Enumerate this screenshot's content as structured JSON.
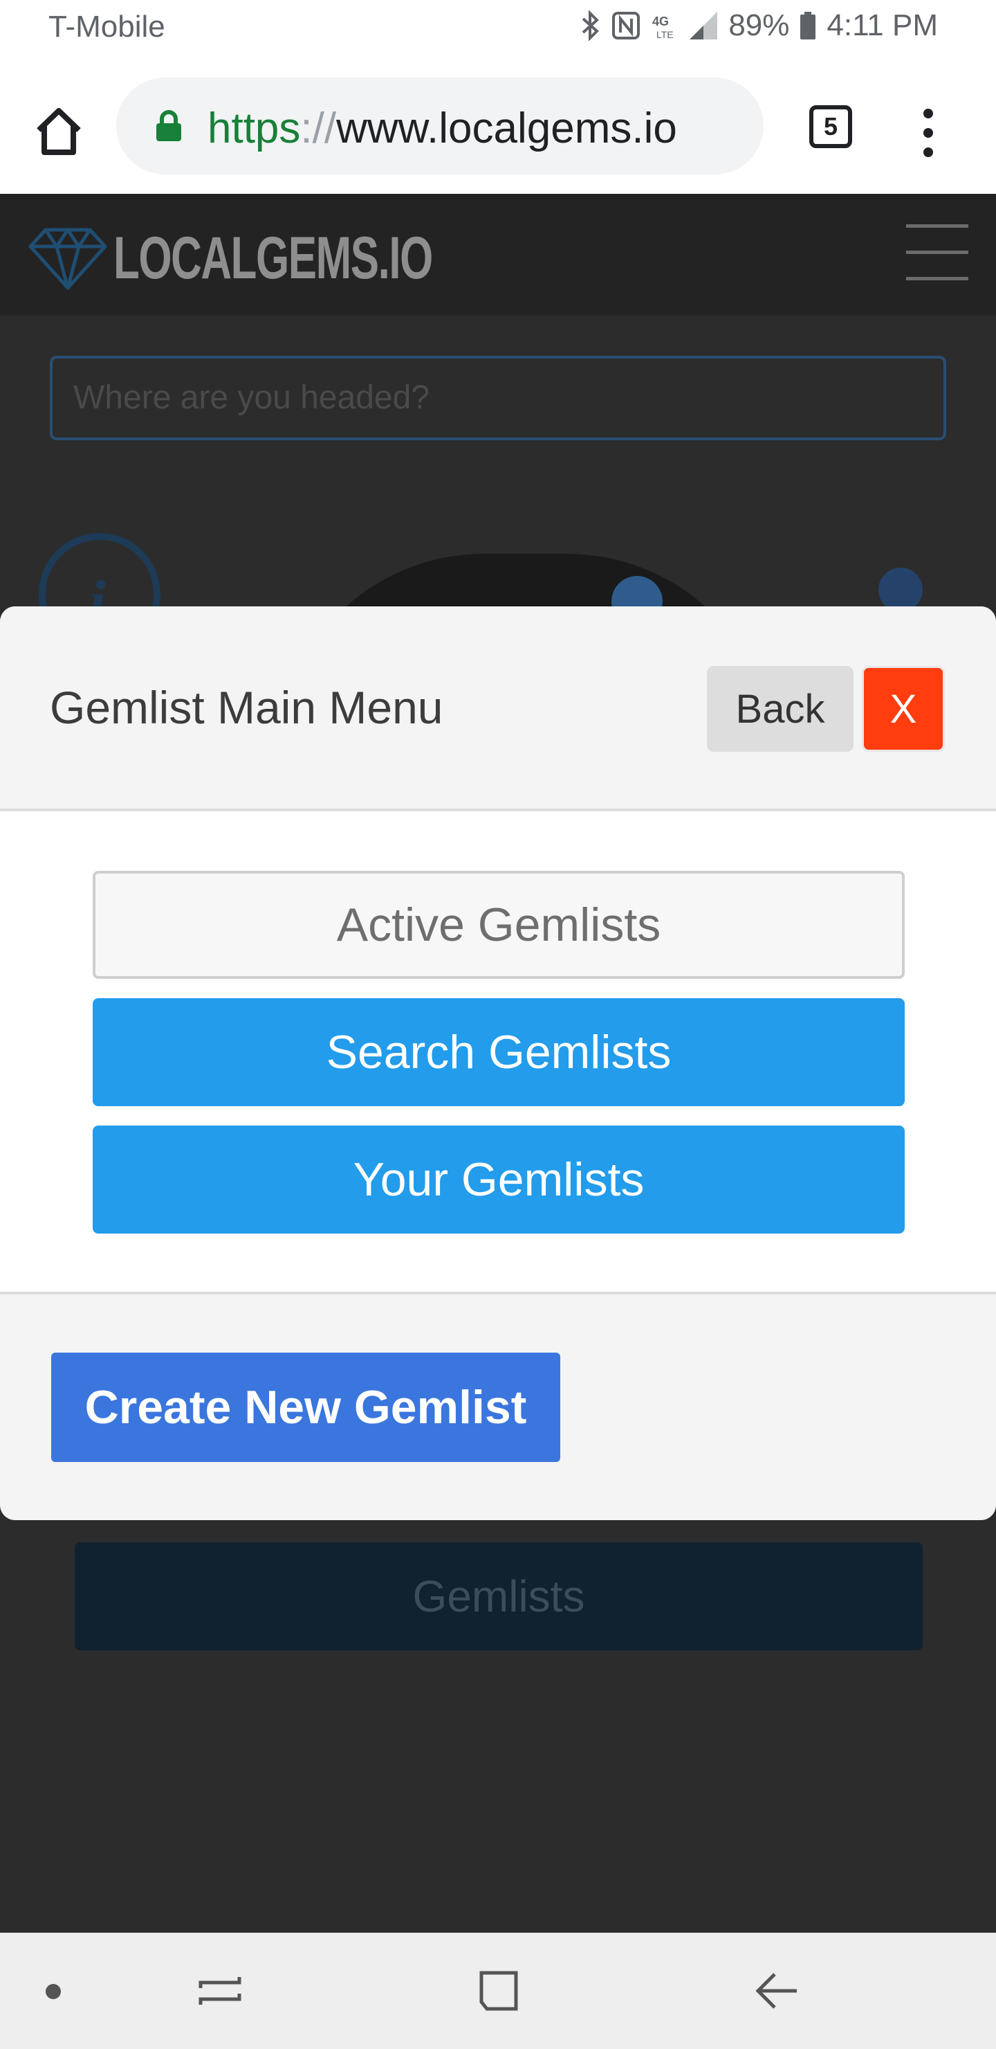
{
  "status_bar": {
    "carrier": "T-Mobile",
    "network": "4G LTE",
    "battery": "89%",
    "time": "4:11 PM"
  },
  "browser": {
    "url_scheme": "https",
    "url_separator": "://",
    "url_host": "www.localgems.io",
    "tab_count": "5",
    "icons": [
      "home-icon",
      "lock-icon",
      "tabs-icon",
      "more-vert-icon"
    ]
  },
  "site": {
    "logo_text": "LOCALGEMS.IO",
    "search_placeholder": "Where are you headed?",
    "gemlists_button": "Gemlists"
  },
  "modal": {
    "title": "Gemlist Main Menu",
    "back_label": "Back",
    "close_label": "X",
    "menu_items": [
      {
        "label": "Active Gemlists"
      },
      {
        "label": "Search Gemlists"
      },
      {
        "label": "Your Gemlists"
      }
    ],
    "create_label": "Create New Gemlist"
  },
  "colors": {
    "primary_blue": "#239ceb",
    "create_blue": "#3a76dd",
    "close_red": "#ff3d0f",
    "url_green": "#188038"
  }
}
